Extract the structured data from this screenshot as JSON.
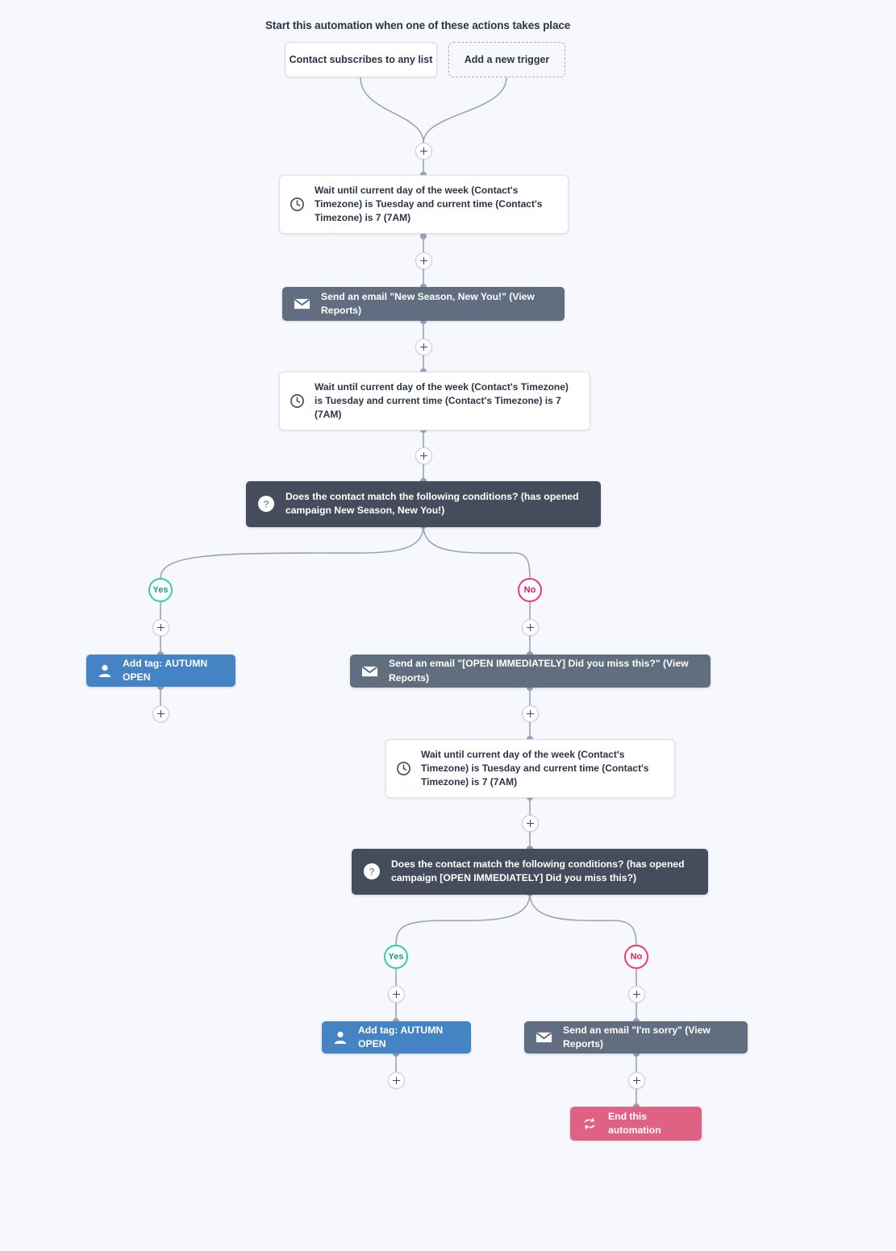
{
  "flow": {
    "title": "Start this automation when one of these actions takes place",
    "triggers": [
      {
        "label": "Contact subscribes to any list",
        "style": "solid"
      },
      {
        "label": "Add a new trigger",
        "style": "dashed"
      }
    ],
    "nodes": [
      {
        "id": "wait-1",
        "kind": "wait",
        "icon": "clock-icon",
        "text": "Wait until current day of the week (Contact's Timezone) is Tuesday and current time (Contact's Timezone) is 7 (7AM)"
      },
      {
        "id": "email-1",
        "kind": "email",
        "icon": "envelope-icon",
        "text": "Send an email \"New Season, New You!\" (View Reports)"
      },
      {
        "id": "wait-2",
        "kind": "wait",
        "icon": "clock-icon",
        "text": "Wait until current day of the week (Contact's Timezone) is Tuesday and current time (Contact's Timezone) is 7 (7AM)"
      },
      {
        "id": "cond-1",
        "kind": "condition",
        "icon": "question-icon",
        "text": "Does the contact match the following conditions? (has opened campaign New Season, New You!)"
      },
      {
        "id": "tag-1",
        "kind": "tag",
        "icon": "person-icon",
        "text": "Add tag: AUTUMN OPEN"
      },
      {
        "id": "email-2",
        "kind": "email",
        "icon": "envelope-icon",
        "text": "Send an email \"[OPEN IMMEDIATELY] Did you miss this?\" (View Reports)"
      },
      {
        "id": "wait-3",
        "kind": "wait",
        "icon": "clock-icon",
        "text": "Wait until current day of the week (Contact's Timezone) is Tuesday and current time (Contact's Timezone) is 7 (7AM)"
      },
      {
        "id": "cond-2",
        "kind": "condition",
        "icon": "question-icon",
        "text": "Does the contact match the following conditions? (has opened campaign [OPEN IMMEDIATELY] Did you miss this?)"
      },
      {
        "id": "tag-2",
        "kind": "tag",
        "icon": "person-icon",
        "text": "Add tag: AUTUMN OPEN"
      },
      {
        "id": "email-3",
        "kind": "email",
        "icon": "envelope-icon",
        "text": "Send an email \"I'm sorry\" (View Reports)"
      },
      {
        "id": "end-1",
        "kind": "end",
        "icon": "end-automation-icon",
        "text": "End this automation"
      }
    ],
    "branch_labels": {
      "yes": "Yes",
      "no": "No"
    },
    "add_step_label": "+",
    "colors": {
      "background": "#f7f8fd",
      "email_node": "#616e7f",
      "condition_node": "#454c5c",
      "tag_node": "#4484c4",
      "end_node": "#df6285",
      "wait_node": "#ffffff",
      "connector": "#9aa3b8",
      "yes_branch": "#2ecfa4",
      "no_branch": "#f3376b"
    }
  }
}
